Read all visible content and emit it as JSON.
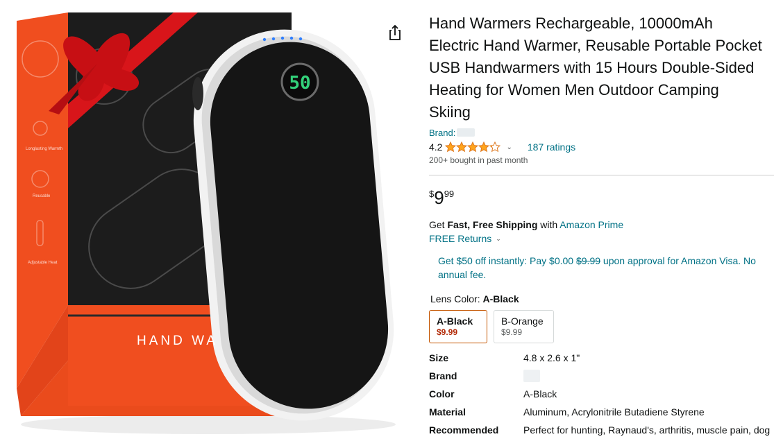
{
  "product": {
    "title": "Hand Warmers Rechargeable, 10000mAh Electric Hand Warmer, Reusable Portable Pocket USB Handwarmers with 15 Hours Double-Sided Heating for Women Men Outdoor Camping Skiing",
    "brand_label": "Brand:",
    "rating_value": "4.2",
    "rating_stars": 4.2,
    "ratings_count": "187 ratings",
    "bought_text": "200+ bought in past month"
  },
  "image": {
    "box_text": "HAND WA",
    "box_features": [
      "Longlasting Warmth",
      "Reusable",
      "Adjustable Heat"
    ],
    "display_number": "50",
    "colors": {
      "box_orange": "#f04e1f",
      "box_black": "#1c1c1c",
      "ribbon": "#d8151a",
      "device": "#151515",
      "screen_green": "#33d17a"
    }
  },
  "price": {
    "symbol": "$",
    "whole": "9",
    "fraction": "99"
  },
  "shipping": {
    "prefix": "Get",
    "bold": "Fast, Free Shipping",
    "middle": "with",
    "prime_link": "Amazon Prime",
    "returns": "FREE Returns"
  },
  "promo": {
    "part1": "Get $50 off instantly: Pay $0.00",
    "struck": "$9.99",
    "part2": "upon approval for Amazon Visa. No annual fee."
  },
  "variation": {
    "label": "Lens Color:",
    "selected": "A-Black",
    "options": [
      {
        "name": "A-Black",
        "price": "$9.99"
      },
      {
        "name": "B-Orange",
        "price": "$9.99"
      }
    ]
  },
  "specs": [
    {
      "key": "Size",
      "value": "4.8 x 2.6 x 1\""
    },
    {
      "key": "Brand",
      "value": ""
    },
    {
      "key": "Color",
      "value": "A-Black"
    },
    {
      "key": "Material",
      "value": "Aluminum, Acrylonitrile Butadiene Styrene"
    },
    {
      "key": "Recommended Uses For Product",
      "value": "Perfect for hunting, Raynaud's, arthritis, muscle pain, dog walking, outdoor work, skiing, golf, watching games in the"
    }
  ],
  "theme": {
    "link": "#007185",
    "price_red": "#b12704",
    "selected_border": "#c45500",
    "star": "#ffa41c"
  }
}
